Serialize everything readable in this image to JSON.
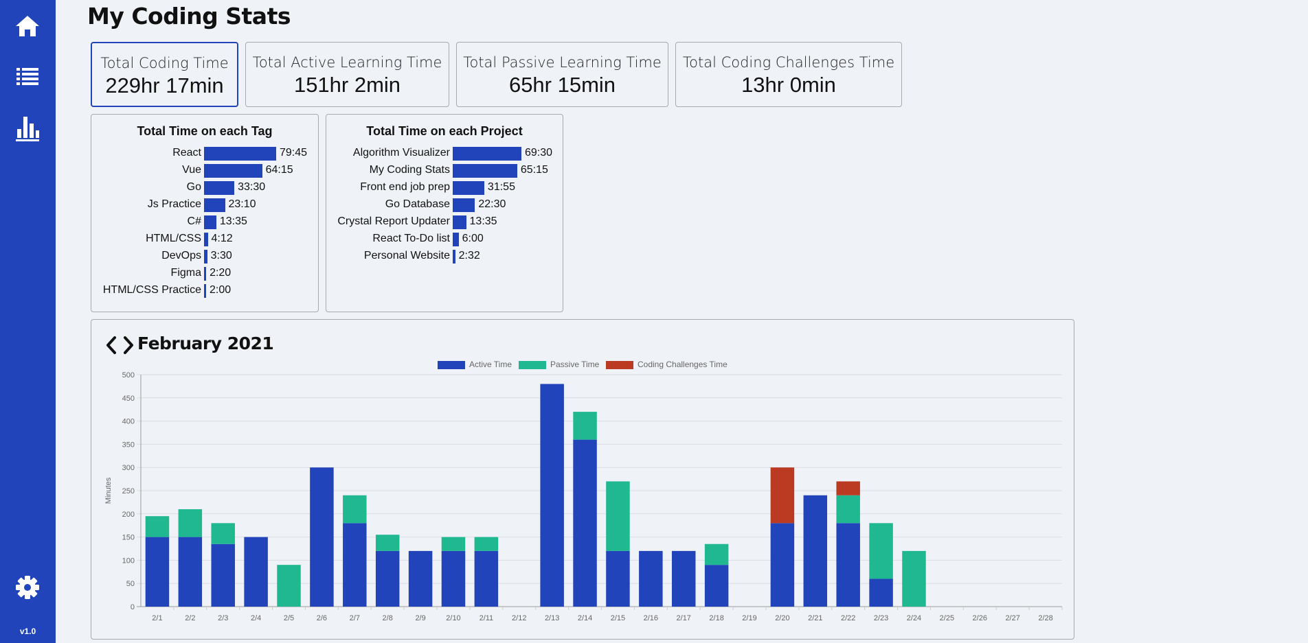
{
  "app": {
    "title": "My Coding Stats",
    "version": "v1.0"
  },
  "sidebar": [
    {
      "icon": "home-icon"
    },
    {
      "icon": "list-icon"
    },
    {
      "icon": "bar-chart-icon"
    }
  ],
  "settings": {
    "icon": "gear-icon"
  },
  "totals": [
    {
      "label": "Total Coding Time",
      "value": "229hr 17min",
      "active": true
    },
    {
      "label": "Total Active Learning Time",
      "value": "151hr 2min"
    },
    {
      "label": "Total Passive Learning Time",
      "value": "65hr 15min"
    },
    {
      "label": "Total Coding Challenges Time",
      "value": "13hr 0min"
    }
  ],
  "tags": {
    "title": "Total Time on each Tag",
    "items": [
      {
        "name": "React",
        "time": "79:45",
        "minutes": 4785
      },
      {
        "name": "Vue",
        "time": "64:15",
        "minutes": 3855
      },
      {
        "name": "Go",
        "time": "33:30",
        "minutes": 2010
      },
      {
        "name": "Js Practice",
        "time": "23:10",
        "minutes": 1390
      },
      {
        "name": "C#",
        "time": "13:35",
        "minutes": 815
      },
      {
        "name": "HTML/CSS",
        "time": "4:12",
        "minutes": 252
      },
      {
        "name": "DevOps",
        "time": "3:30",
        "minutes": 210
      },
      {
        "name": "Figma",
        "time": "2:20",
        "minutes": 140
      },
      {
        "name": "HTML/CSS Practice",
        "time": "2:00",
        "minutes": 120
      }
    ]
  },
  "projects": {
    "title": "Total Time on each Project",
    "items": [
      {
        "name": "Algorithm Visualizer",
        "time": "69:30",
        "minutes": 4170
      },
      {
        "name": "My Coding Stats",
        "time": "65:15",
        "minutes": 3915
      },
      {
        "name": "Front end job prep",
        "time": "31:55",
        "minutes": 1915
      },
      {
        "name": "Go Database",
        "time": "22:30",
        "minutes": 1350
      },
      {
        "name": "Crystal Report Updater",
        "time": "13:35",
        "minutes": 815
      },
      {
        "name": "React To-Do list",
        "time": "6:00",
        "minutes": 360
      },
      {
        "name": "Personal Website",
        "time": "2:32",
        "minutes": 152
      }
    ]
  },
  "calendar": {
    "month": "February 2021",
    "prev_icon": "chevron-left-icon",
    "next_icon": "chevron-right-icon"
  },
  "chart_data": {
    "type": "bar",
    "stacked": true,
    "ylabel": "Minutes",
    "ylim": [
      0,
      500
    ],
    "yticks": [
      0,
      50,
      100,
      150,
      200,
      250,
      300,
      350,
      400,
      450,
      500
    ],
    "grid": true,
    "legend_position": "top",
    "categories": [
      "2/1",
      "2/2",
      "2/3",
      "2/4",
      "2/5",
      "2/6",
      "2/7",
      "2/8",
      "2/9",
      "2/10",
      "2/11",
      "2/12",
      "2/13",
      "2/14",
      "2/15",
      "2/16",
      "2/17",
      "2/18",
      "2/19",
      "2/20",
      "2/21",
      "2/22",
      "2/23",
      "2/24",
      "2/25",
      "2/26",
      "2/27",
      "2/28"
    ],
    "series": [
      {
        "name": "Active Time",
        "color": "#2244bb",
        "values": [
          150,
          150,
          135,
          150,
          0,
          300,
          180,
          120,
          120,
          120,
          120,
          0,
          480,
          360,
          120,
          120,
          120,
          90,
          0,
          180,
          240,
          180,
          60,
          0,
          0,
          0,
          0,
          0
        ]
      },
      {
        "name": "Passive Time",
        "color": "#20b890",
        "values": [
          45,
          60,
          45,
          0,
          90,
          0,
          60,
          35,
          0,
          30,
          30,
          0,
          0,
          60,
          150,
          0,
          0,
          45,
          0,
          0,
          0,
          60,
          120,
          120,
          0,
          0,
          0,
          0
        ]
      },
      {
        "name": "Coding Challenges Time",
        "color": "#bb3a22",
        "values": [
          0,
          0,
          0,
          0,
          0,
          0,
          0,
          0,
          0,
          0,
          0,
          0,
          0,
          0,
          0,
          0,
          0,
          0,
          0,
          120,
          0,
          30,
          0,
          0,
          0,
          0,
          0,
          0
        ]
      }
    ]
  }
}
